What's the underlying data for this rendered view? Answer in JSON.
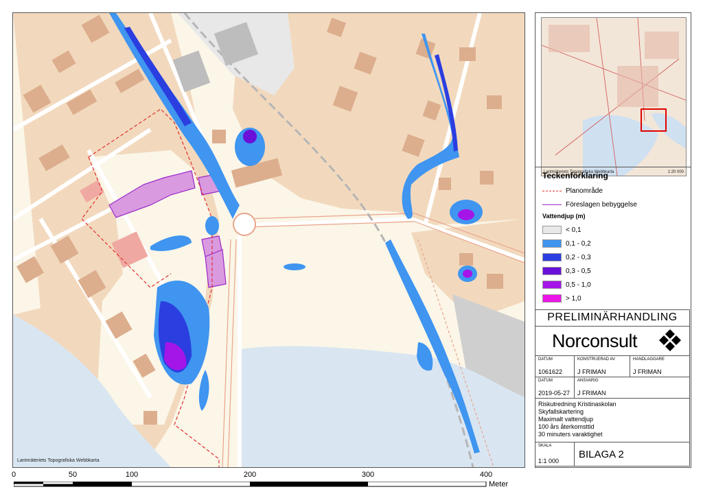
{
  "map": {
    "credit": "Lantmäteriets Topografiska Webbkarta",
    "colors": {
      "land": "#fbf6e8",
      "residential": "#f2d9bd",
      "building": "#dcae8e",
      "water": "#d9e6f2",
      "road": "#ffffff",
      "depth_02": "#3f8ff0",
      "depth_03": "#2f3fe0",
      "depth_05": "#6a1ed0",
      "depth_10": "#a11ee0",
      "depth_max": "#e31ce0"
    }
  },
  "scalebar": {
    "labels": [
      "0",
      "50",
      "100",
      "200",
      "300",
      "400"
    ],
    "unit": "Meter"
  },
  "overview": {
    "credit": "Lantmäteriets Topografiska Webbkarta",
    "scale": "1:20 000"
  },
  "legend": {
    "title": "Teckenförklaring",
    "lines": [
      {
        "label": "Planområde",
        "color": "#e03030",
        "style": "dashed"
      },
      {
        "label": "Föreslagen bebyggelse",
        "color": "#9b27c9",
        "style": "solid"
      }
    ],
    "depth_title": "Vattendjup (m)",
    "classes": [
      {
        "label": "< 0,1",
        "color": "#e8e8e8"
      },
      {
        "label": "0,1 - 0,2",
        "color": "#3f95f0"
      },
      {
        "label": "0,2 - 0,3",
        "color": "#2b3ee0"
      },
      {
        "label": "0,3 - 0,5",
        "color": "#6a10d8"
      },
      {
        "label": "0,5 - 1,0",
        "color": "#a415e8"
      },
      {
        "label": "> 1,0",
        "color": "#ec15e8"
      }
    ]
  },
  "titleblock": {
    "status": "PRELIMINÄRHANDLING",
    "company": "Norconsult",
    "datum_label": "DATUM",
    "datum_value": "1061622",
    "konstruerad_label": "KONSTRUERAD AV",
    "konstruerad_value": "J FRIMAN",
    "handlaggare_label": "HANDLAGGARE",
    "handlaggare_value": "J FRIMAN",
    "datum2_label": "DATUM",
    "datum2_value": "2019-05-27",
    "ansvarig_label": "ANSVARIG",
    "ansvarig_value": "J FRIMAN",
    "description": [
      "Riskutredning Kristinaskolan",
      "Skyfallskartering",
      "Maximalt vattendjup",
      "100 års återkomsttid",
      "30 minuters varaktighet"
    ],
    "skala_label": "SKALA",
    "skala_value": "1:1 000",
    "bilaga": "BILAGA 2"
  }
}
